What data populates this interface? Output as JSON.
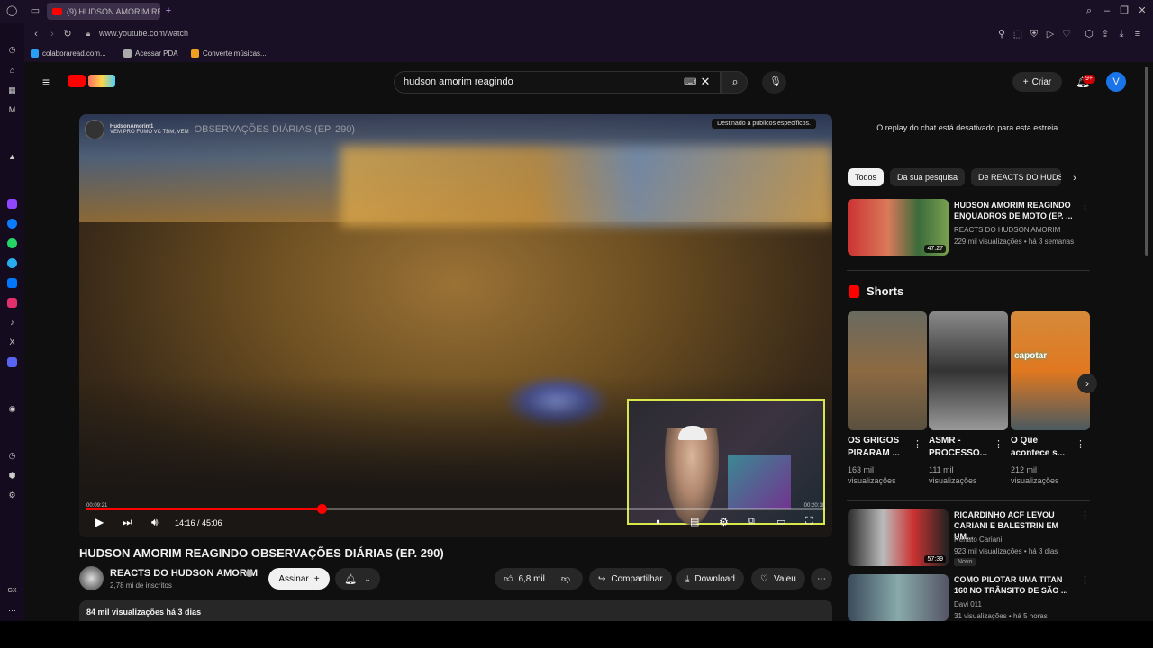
{
  "browser": {
    "tab_title": "(9) HUDSON AMORIM RE",
    "url": "www.youtube.com/watch",
    "bookmarks": [
      "colaboraread.com...",
      "Acessar PDA",
      "Converte músicas..."
    ],
    "new_tab": "+"
  },
  "header": {
    "search_query": "hudson amorim reagindo",
    "create_label": "Criar",
    "notifications_badge": "9+",
    "avatar_letter": "V"
  },
  "player": {
    "overlay_channel": "HudsonAmorim1",
    "overlay_title": "OBSERVAÇÕES DIÁRIAS (EP. 290)",
    "overlay_subtitle": "VEM PRO FUMO VC TBM, VEM",
    "audience_pill": "Destinado a públicos específicos.",
    "current_time": "14:16 / 45:06",
    "inner_time_left": "00:09:21",
    "inner_time_right": "00:20:10",
    "progress_fraction": 0.318
  },
  "video": {
    "title": "HUDSON AMORIM REAGINDO OBSERVAÇÕES DIÁRIAS (EP. 290)",
    "channel": "REACTS DO HUDSON AMORIM",
    "subscribers": "2,78 mi de inscritos",
    "subscribe_label": "Assinar",
    "likes": "6,8 mil",
    "share_label": "Compartilhar",
    "download_label": "Download",
    "thanks_label": "Valeu",
    "views_date": "84 mil visualizações  há 3 dias"
  },
  "sidebar": {
    "chat_message": "O replay do chat está desativado para esta estreia.",
    "chips": [
      "Todos",
      "Da sua pesquisa",
      "De REACTS DO HUDS"
    ],
    "first_rec": {
      "title": "HUDSON AMORIM REAGINDO ENQUADROS DE MOTO (EP. ...",
      "channel": "REACTS DO HUDSON AMORIM",
      "meta": "229 mil visualizações  •  há 3 semanas",
      "duration": "47:27"
    },
    "shorts_label": "Shorts",
    "shorts": [
      {
        "title": "OS GRIGOS PIRARAM ...",
        "views": "163 mil visualizações"
      },
      {
        "title": "ASMR - PROCESSO...",
        "views": "111 mil visualizações"
      },
      {
        "title": "O Que acontece s...",
        "views": "212 mil visualizações",
        "overlay": "capotar"
      }
    ],
    "recs": [
      {
        "title": "RICARDINHO ACF LEVOU CARIANI E BALESTRIN EM UM...",
        "channel": "Renato Cariani",
        "meta": "923 mil visualizações  •  há 3 dias",
        "badge": "Novo",
        "duration": "57:39"
      },
      {
        "title": "COMO PILOTAR UMA TITAN 160 NO TRÂNSITO DE SÃO ...",
        "channel": "Davi 011",
        "meta": "31 visualizações  •  há 5 horas",
        "duration": ""
      }
    ]
  }
}
